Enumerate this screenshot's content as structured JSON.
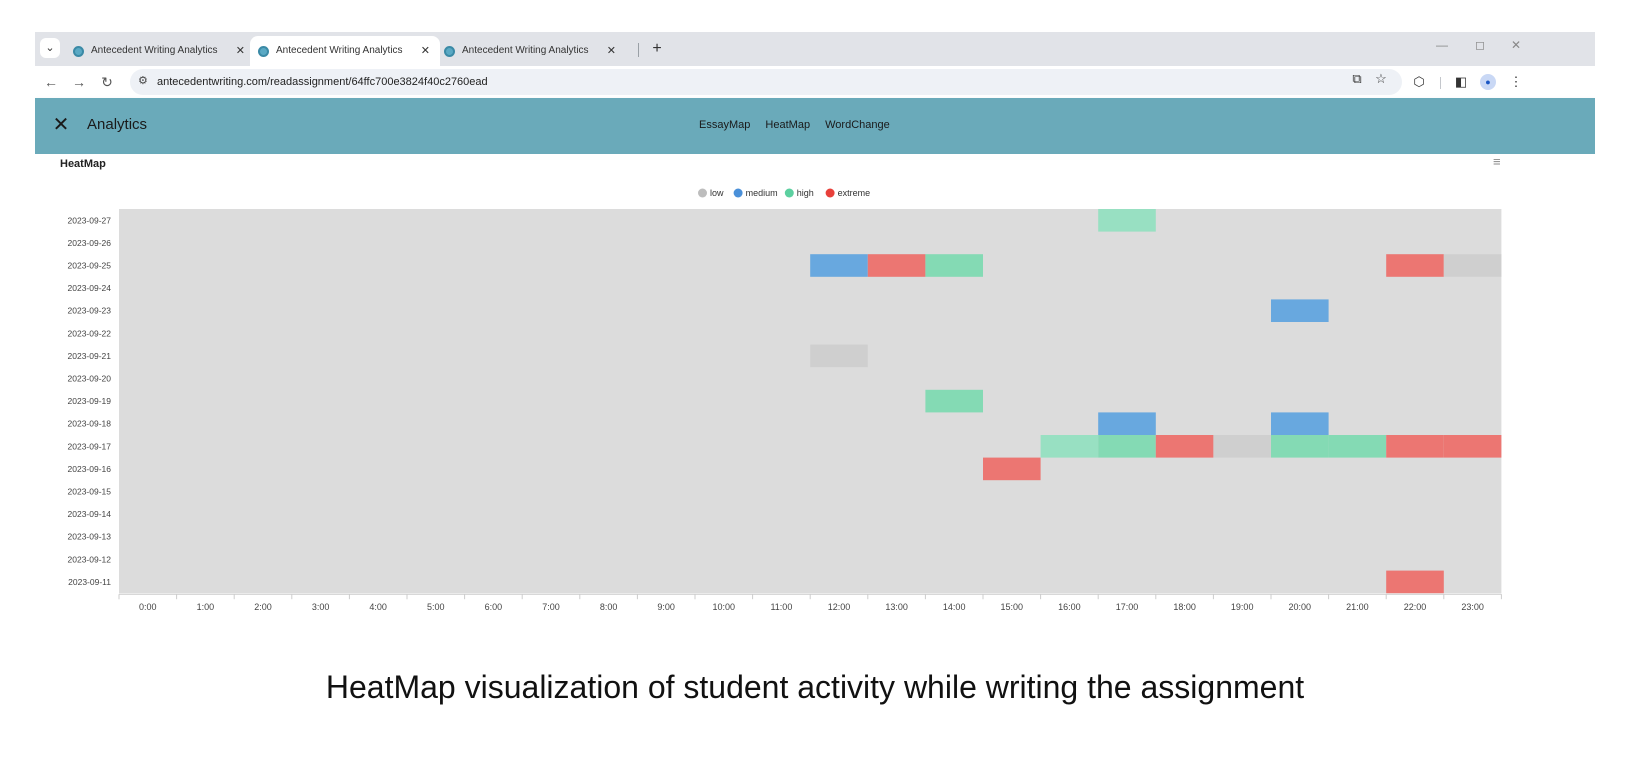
{
  "browser": {
    "tabs": [
      {
        "title": "Antecedent Writing Analytics",
        "active": false
      },
      {
        "title": "Antecedent Writing Analytics",
        "active": true
      },
      {
        "title": "Antecedent Writing Analytics",
        "active": false
      }
    ],
    "url": "antecedentwriting.com/readassignment/64ffc700e3824f40c2760ead"
  },
  "app": {
    "title": "Analytics",
    "nav": [
      "EssayMap",
      "HeatMap",
      "WordChange"
    ]
  },
  "chart_data": {
    "type": "heatmap",
    "title": "HeatMap",
    "legend": [
      {
        "name": "low",
        "color": "#bdbdbd"
      },
      {
        "name": "medium",
        "color": "#4a90d9"
      },
      {
        "name": "high",
        "color": "#5cd0a0"
      },
      {
        "name": "extreme",
        "color": "#e8403a"
      }
    ],
    "legend_position": "top-center",
    "cell_colors": {
      "low": "#cfcfcf",
      "medium": "#68a8df",
      "high": "#84dab4",
      "high_light": "#98e0c2",
      "extreme": "#ec7672"
    },
    "background_color": "#dcdcdc",
    "x_labels": [
      "0:00",
      "1:00",
      "2:00",
      "3:00",
      "4:00",
      "5:00",
      "6:00",
      "7:00",
      "8:00",
      "9:00",
      "10:00",
      "11:00",
      "12:00",
      "13:00",
      "14:00",
      "15:00",
      "16:00",
      "17:00",
      "18:00",
      "19:00",
      "20:00",
      "21:00",
      "22:00",
      "23:00"
    ],
    "y_labels": [
      "2023-09-27",
      "2023-09-26",
      "2023-09-25",
      "2023-09-24",
      "2023-09-23",
      "2023-09-22",
      "2023-09-21",
      "2023-09-20",
      "2023-09-19",
      "2023-09-18",
      "2023-09-17",
      "2023-09-16",
      "2023-09-15",
      "2023-09-14",
      "2023-09-13",
      "2023-09-12",
      "2023-09-11"
    ],
    "cells": [
      {
        "date": "2023-09-27",
        "hour": "17:00",
        "level": "high_light"
      },
      {
        "date": "2023-09-25",
        "hour": "12:00",
        "level": "medium"
      },
      {
        "date": "2023-09-25",
        "hour": "13:00",
        "level": "extreme"
      },
      {
        "date": "2023-09-25",
        "hour": "14:00",
        "level": "high"
      },
      {
        "date": "2023-09-25",
        "hour": "22:00",
        "level": "extreme"
      },
      {
        "date": "2023-09-25",
        "hour": "23:00",
        "level": "low"
      },
      {
        "date": "2023-09-23",
        "hour": "20:00",
        "level": "medium"
      },
      {
        "date": "2023-09-21",
        "hour": "12:00",
        "level": "low"
      },
      {
        "date": "2023-09-19",
        "hour": "14:00",
        "level": "high"
      },
      {
        "date": "2023-09-18",
        "hour": "17:00",
        "level": "medium"
      },
      {
        "date": "2023-09-18",
        "hour": "20:00",
        "level": "medium"
      },
      {
        "date": "2023-09-17",
        "hour": "16:00",
        "level": "high_light"
      },
      {
        "date": "2023-09-17",
        "hour": "17:00",
        "level": "high"
      },
      {
        "date": "2023-09-17",
        "hour": "18:00",
        "level": "extreme"
      },
      {
        "date": "2023-09-17",
        "hour": "19:00",
        "level": "low"
      },
      {
        "date": "2023-09-17",
        "hour": "20:00",
        "level": "high"
      },
      {
        "date": "2023-09-17",
        "hour": "21:00",
        "level": "high"
      },
      {
        "date": "2023-09-17",
        "hour": "22:00",
        "level": "extreme"
      },
      {
        "date": "2023-09-17",
        "hour": "23:00",
        "level": "extreme"
      },
      {
        "date": "2023-09-16",
        "hour": "15:00",
        "level": "extreme"
      },
      {
        "date": "2023-09-11",
        "hour": "22:00",
        "level": "extreme"
      }
    ]
  },
  "caption": "HeatMap visualization of student activity while writing the assignment"
}
